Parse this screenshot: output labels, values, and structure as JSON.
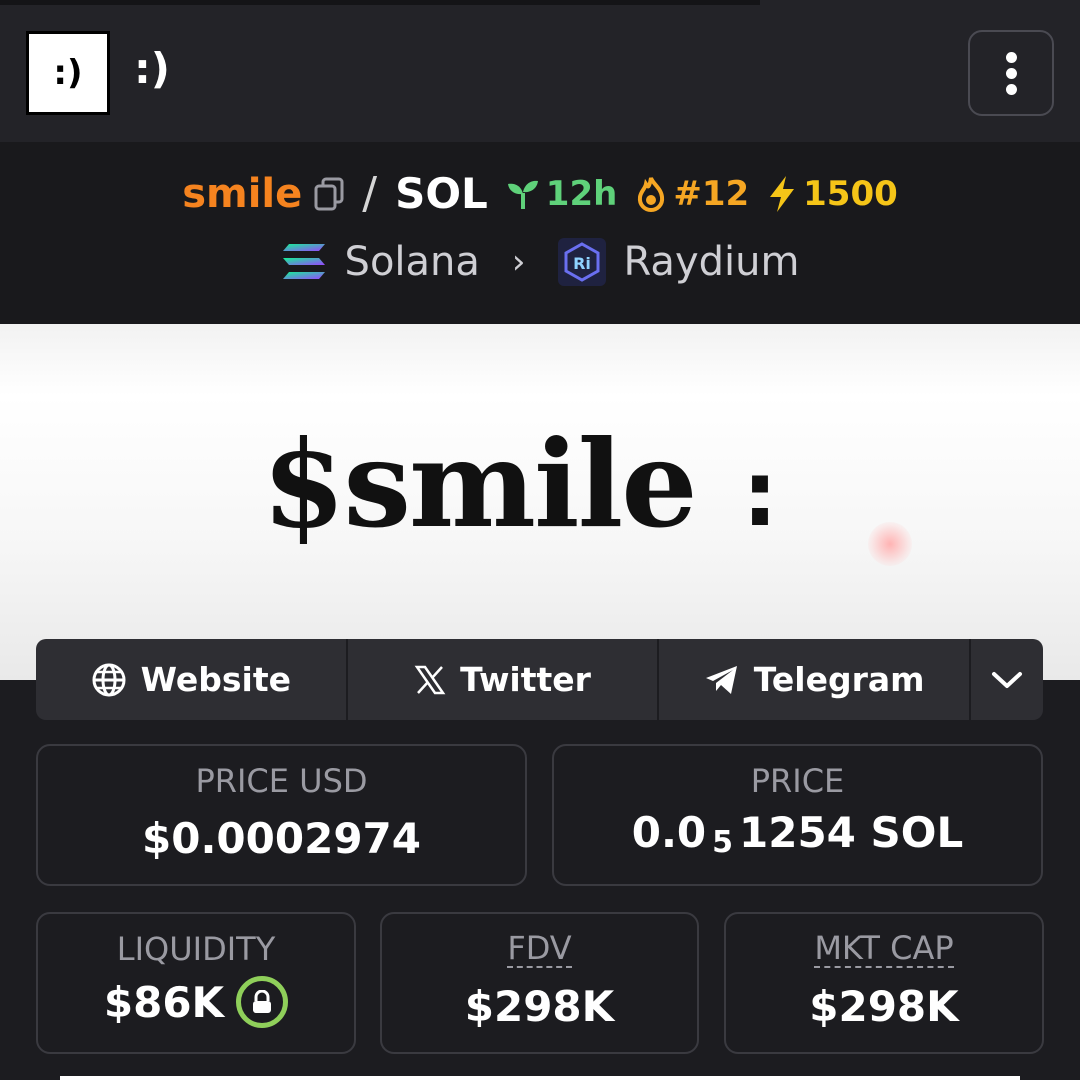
{
  "topbar": {
    "logo_text": ":)",
    "token_label": ":)"
  },
  "pair": {
    "base": "smile",
    "separator": "/",
    "quote": "SOL",
    "age": "12h",
    "rank": "#12",
    "boosts": "1500",
    "chain": "Solana",
    "dex": "Raydium",
    "dex_icon_text": "Ri"
  },
  "banner": {
    "text": "$smile",
    "colon": ":"
  },
  "links": {
    "website": "Website",
    "twitter": "Twitter",
    "telegram": "Telegram"
  },
  "stats": {
    "price_usd_label": "PRICE USD",
    "price_usd": "$0.0002974",
    "price_label": "PRICE",
    "price_prefix": "0.0",
    "price_zeros": "5",
    "price_digits": "1254 SOL",
    "liquidity_label": "LIQUIDITY",
    "liquidity": "$86K",
    "fdv_label": "FDV",
    "fdv": "$298K",
    "mktcap_label": "MKT CAP",
    "mktcap": "$298K"
  },
  "colors": {
    "base_token": "#f5831f",
    "age": "#5fd17a",
    "rank": "#f5a623",
    "boost": "#f5c518",
    "lock_ring": "#8fcf5a"
  }
}
